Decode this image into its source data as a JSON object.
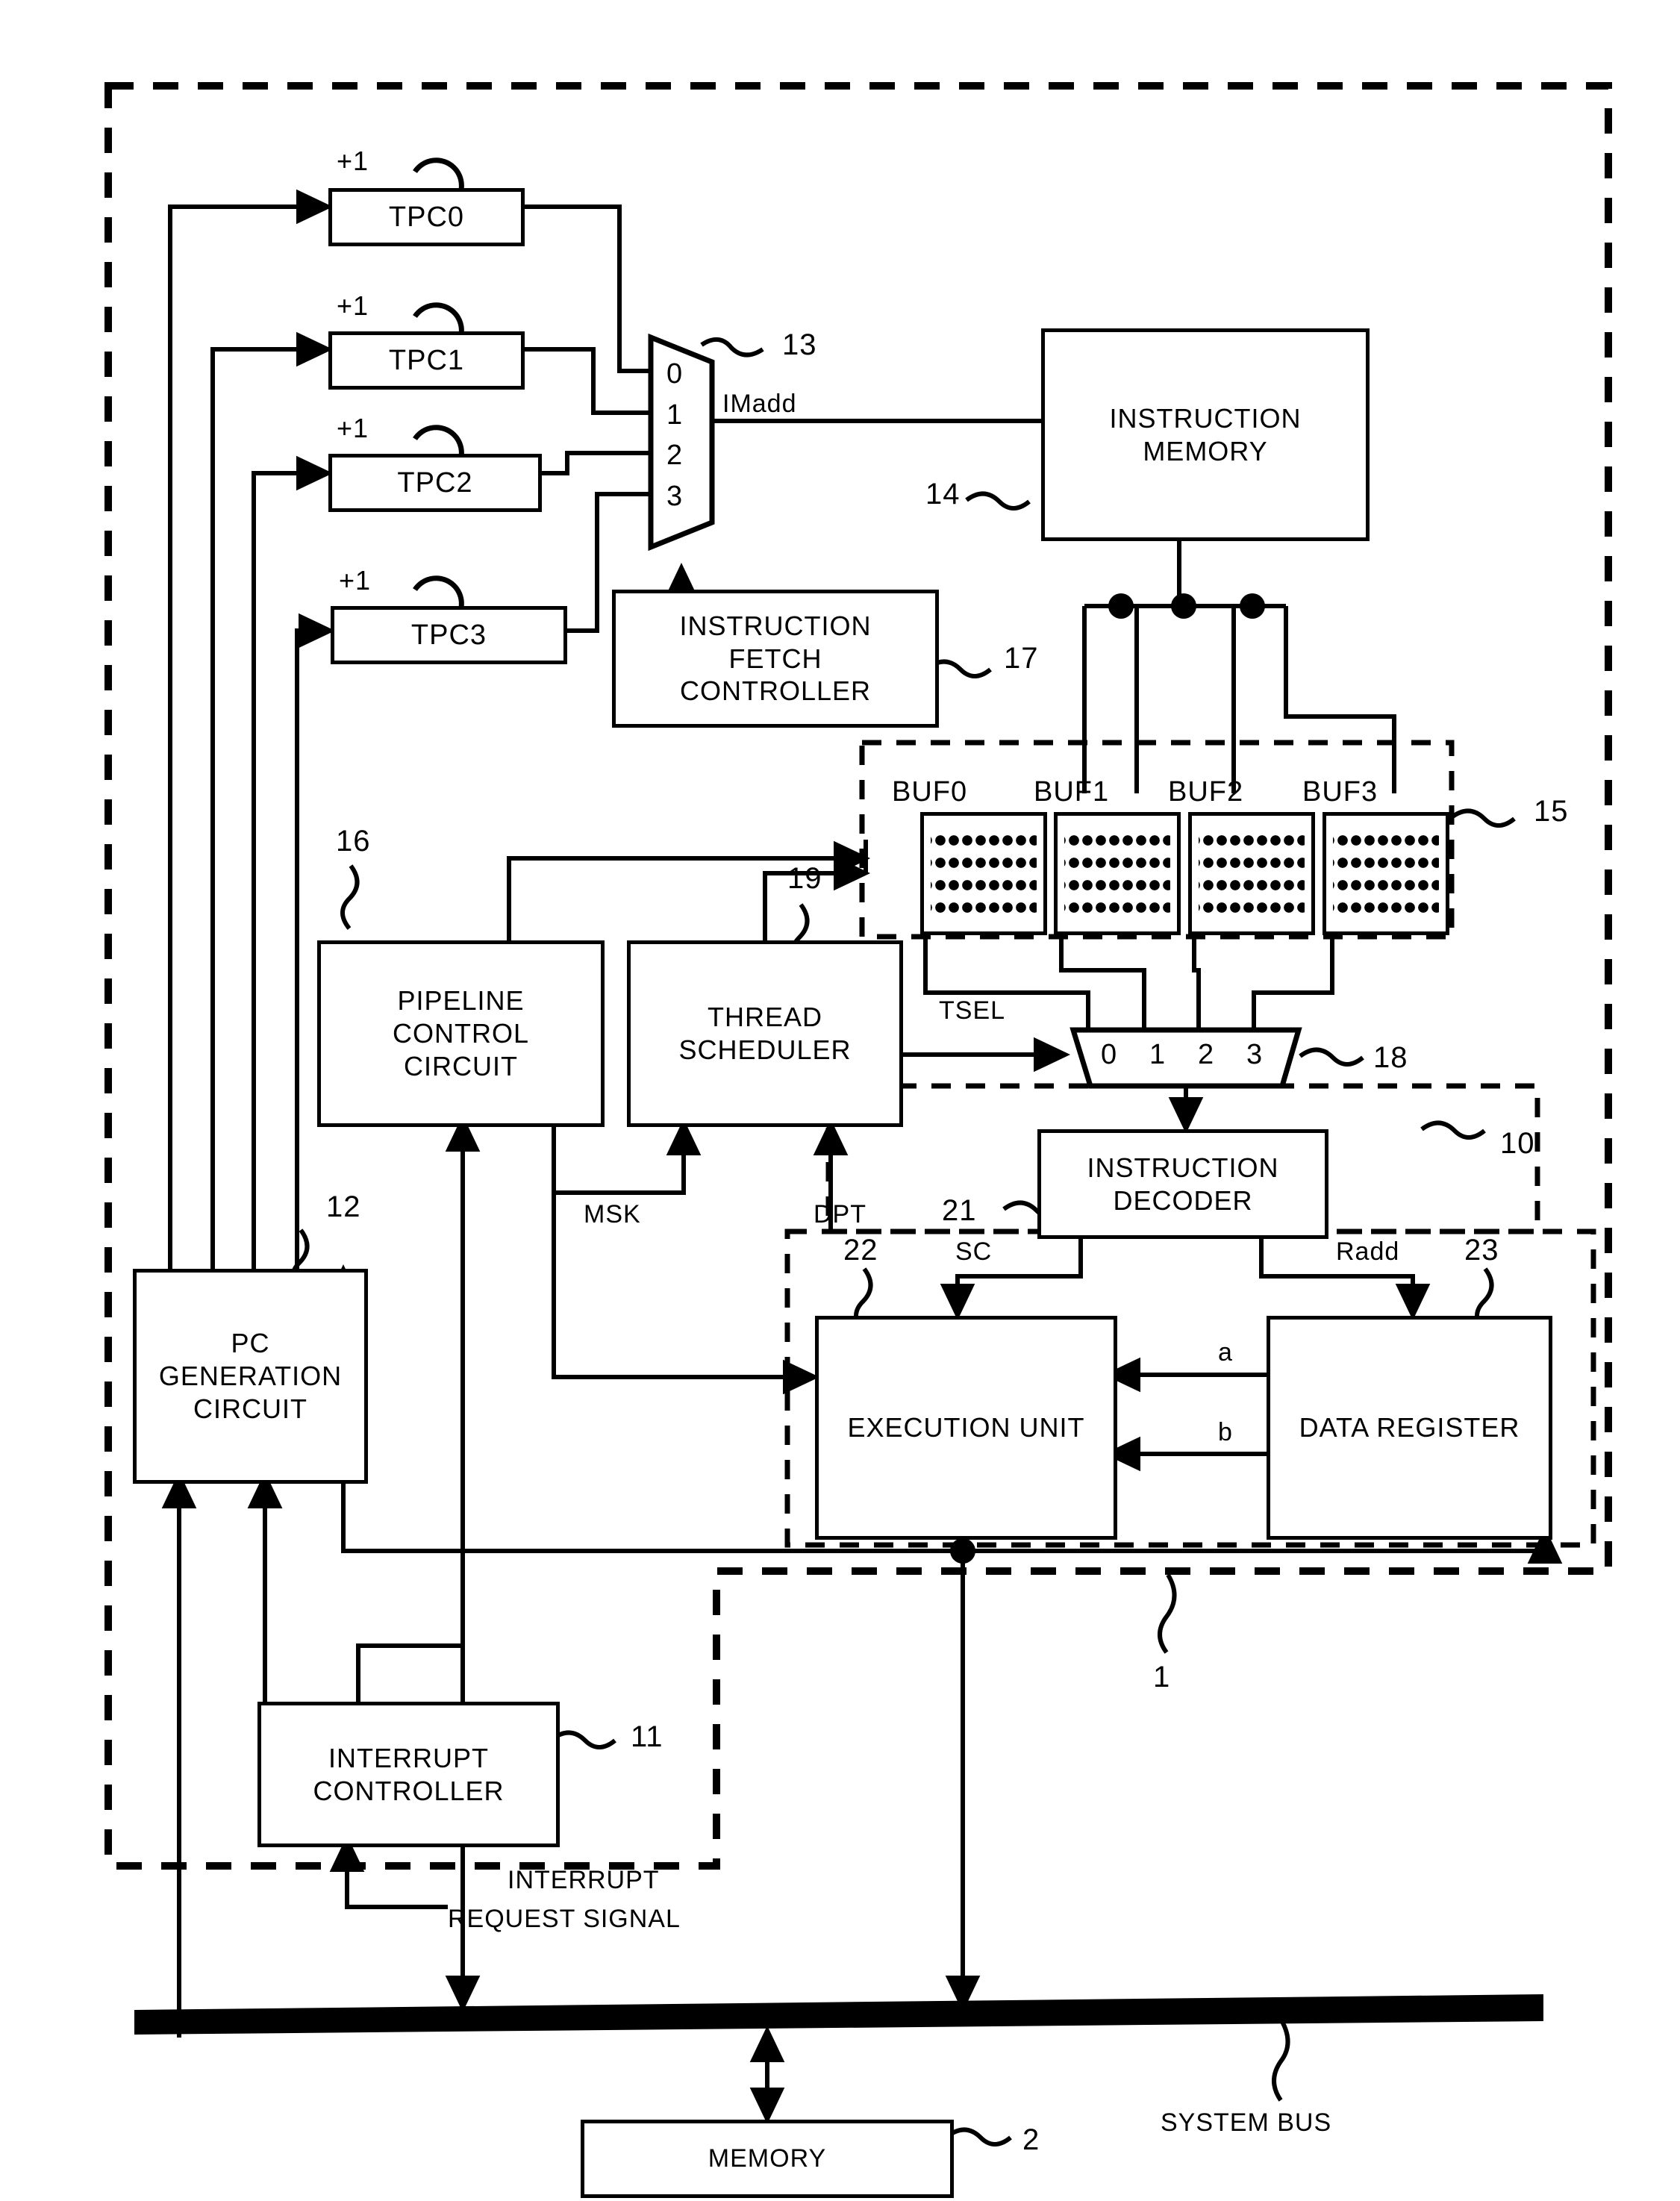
{
  "figure": {
    "domain_type": "patent-block-diagram",
    "title": "Multithread processor block diagram"
  },
  "blocks": {
    "tpc0": {
      "label": "TPC0",
      "increment": "+1"
    },
    "tpc1": {
      "label": "TPC1",
      "increment": "+1"
    },
    "tpc2": {
      "label": "TPC2",
      "increment": "+1"
    },
    "tpc3": {
      "label": "TPC3",
      "increment": "+1"
    },
    "instruction_memory": {
      "line1": "INSTRUCTION",
      "line2": "MEMORY",
      "ref": "14"
    },
    "instruction_fetch_controller": {
      "line1": "INSTRUCTION",
      "line2": "FETCH",
      "line3": "CONTROLLER",
      "ref": "17"
    },
    "pipeline_control_circuit": {
      "line1": "PIPELINE",
      "line2": "CONTROL",
      "line3": "CIRCUIT",
      "ref": "16"
    },
    "thread_scheduler": {
      "line1": "THREAD",
      "line2": "SCHEDULER",
      "ref": "19"
    },
    "instruction_decoder": {
      "line1": "INSTRUCTION",
      "line2": "DECODER",
      "ref": "21"
    },
    "execution_unit": {
      "label": "EXECUTION UNIT",
      "ref": "22"
    },
    "data_register": {
      "label": "DATA REGISTER",
      "ref": "23"
    },
    "pc_generation_circuit": {
      "line1": "PC",
      "line2": "GENERATION",
      "line3": "CIRCUIT",
      "ref": "12"
    },
    "interrupt_controller": {
      "line1": "INTERRUPT",
      "line2": "CONTROLLER",
      "ref": "11"
    },
    "memory": {
      "label": "MEMORY",
      "ref": "2"
    }
  },
  "muxes": {
    "pc_mux": {
      "ref": "13",
      "inputs": [
        "0",
        "1",
        "2",
        "3"
      ],
      "output_label": "IMadd"
    },
    "buffer_mux": {
      "ref": "18",
      "inputs": [
        "0",
        "1",
        "2",
        "3"
      ],
      "select_label": "TSEL"
    }
  },
  "buffers": {
    "ref": "15",
    "items": [
      {
        "label": "BUF0"
      },
      {
        "label": "BUF1"
      },
      {
        "label": "BUF2"
      },
      {
        "label": "BUF3"
      }
    ]
  },
  "signals": {
    "imadd": "IMadd",
    "tsel": "TSEL",
    "msk": "MSK",
    "dpt": "DPT",
    "sc": "SC",
    "radd": "Radd",
    "operand_a": "a",
    "operand_b": "b",
    "interrupt_request": {
      "line1": "INTERRUPT",
      "line2": "REQUEST SIGNAL"
    },
    "system_bus": "SYSTEM BUS"
  },
  "refs": {
    "processor_core": "10",
    "processor_chip": "1"
  },
  "colors": {
    "ink": "#000000",
    "paper": "#ffffff"
  }
}
